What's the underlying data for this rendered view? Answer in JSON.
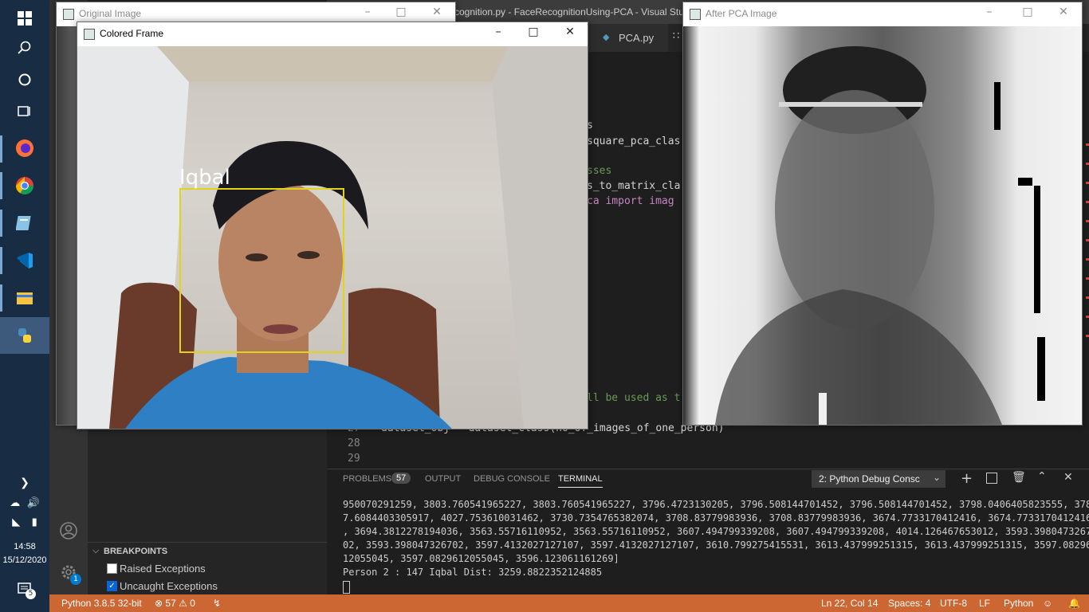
{
  "taskbar": {
    "clock_time": "14:58",
    "clock_date": "15/12/2020",
    "notification_count": "5"
  },
  "vscode": {
    "window_title": "...cognition.py - FaceRecognitionUsing-PCA - Visual Stud",
    "tab_label": "PCA.py",
    "code_fragments": [
      "s",
      "square_pca_clas",
      "sses",
      "s_to_matrix_cla",
      "ca import imag"
    ],
    "code_line_tail": "ll be used as t",
    "code_line_27": "dataset_obj = dataset_class(no_of_images_of_one_person)",
    "line_numbers": [
      "27",
      "28",
      "29"
    ],
    "breakpoints": {
      "title": "BREAKPOINTS",
      "items": [
        {
          "label": "Raised Exceptions",
          "checked": false
        },
        {
          "label": "Uncaught Exceptions",
          "checked": true
        }
      ]
    },
    "panel": {
      "tabs": [
        "PROBLEMS",
        "OUTPUT",
        "DEBUG CONSOLE",
        "TERMINAL"
      ],
      "problems_count": "57",
      "active_tab": "TERMINAL",
      "terminal_select": "2: Python Debug Consc",
      "terminal_lines": [
        "950070291259, 3803.760541965227, 3803.760541965227, 3796.4723130205, 3796.508144701452, 3796.508144701452, 3798.0406405823555, 378",
        "7.6084403305917, 4027.753610031462, 3730.7354765382074, 3708.83779983936, 3708.83779983936, 3674.7733170412416, 3674.7733170412416",
        ", 3694.3812278194036, 3563.55716110952, 3563.55716110952, 3607.494799339208, 3607.494799339208, 4014.126467653012, 3593.3980473267",
        "02, 3593.398047326702, 3597.4132027127107, 3597.4132027127107, 3610.799275415531, 3613.437999251315, 3613.437999251315, 3597.08296",
        "12055045, 3597.0829612055045, 3596.123061161269]",
        "Person 2 : 147 Iqbal Dist: 3259.8822352124885"
      ]
    },
    "statusbar": {
      "python_version": "Python 3.8.5 32-bit",
      "errors": "57",
      "warnings": "0",
      "cursor": "Ln 22, Col 14",
      "spaces": "Spaces: 4",
      "encoding": "UTF-8",
      "eol": "LF",
      "language": "Python"
    },
    "activity_badge": "1"
  },
  "windows": {
    "original": {
      "title": "Original Image"
    },
    "colored": {
      "title": "Colored Frame",
      "face_label": "Iqbal"
    },
    "pca": {
      "title": "After PCA Image"
    }
  }
}
